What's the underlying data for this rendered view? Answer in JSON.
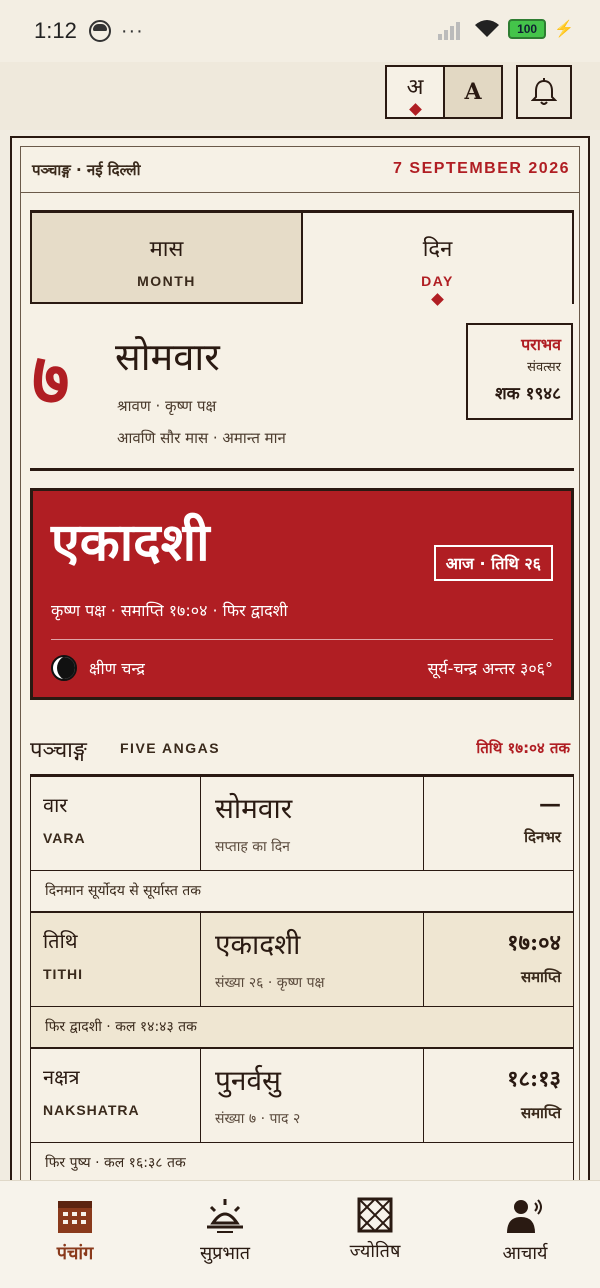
{
  "status_bar": {
    "time": "1:12",
    "dots": "···",
    "battery": "100"
  },
  "toolbar": {
    "lang_hindi": "अ",
    "lang_english": "A"
  },
  "header": {
    "location": "पञ्चाङ्ग · नई दिल्ली",
    "date": "7 SEPTEMBER 2026"
  },
  "tabs": [
    {
      "hindi": "मास",
      "english": "MONTH",
      "active": false
    },
    {
      "hindi": "दिन",
      "english": "DAY",
      "active": true
    }
  ],
  "day": {
    "number": "७",
    "weekday": "सोमवार",
    "line1": "श्रावण · कृष्ण पक्ष",
    "line2": "आवणि सौर मास · अमान्त मान"
  },
  "samvatsara": {
    "name": "पराभव",
    "label": "संवत्सर",
    "year": "शक १९४८"
  },
  "tithi_card": {
    "name": "एकादशी",
    "badge": "आज · तिथि २६",
    "detail": "कृष्ण पक्ष · समाप्ति १७:०४ · फिर द्वादशी",
    "moon_label": "क्षीण चन्द्र",
    "angle": "सूर्य-चन्द्र अन्तर ३०६°"
  },
  "angas_section": {
    "title": "पञ्चाङ्ग",
    "subtitle": "FIVE ANGAS",
    "right": "तिथि १७:०४ तक"
  },
  "angas": [
    {
      "hindi": "वार",
      "english": "VARA",
      "value": "सोमवार",
      "detail": "सप्ताह का दिन",
      "time": "—",
      "time_label": "दिनभर",
      "note": "दिनमान सूर्योदय से सूर्यास्त तक",
      "highlight": false
    },
    {
      "hindi": "तिथि",
      "english": "TITHI",
      "value": "एकादशी",
      "detail": "संख्या २६ · कृष्ण पक्ष",
      "time": "१७:०४",
      "time_label": "समाप्ति",
      "note": "फिर द्वादशी · कल १४:४३ तक",
      "highlight": true
    },
    {
      "hindi": "नक्षत्र",
      "english": "NAKSHATRA",
      "value": "पुनर्वसु",
      "detail": "संख्या ७ · पाद २",
      "time": "१८:१३",
      "time_label": "समाप्ति",
      "note": "फिर पुष्य · कल १६:३८ तक",
      "highlight": false
    }
  ],
  "bottom_nav": [
    {
      "label": "पंचांग",
      "icon": "calendar-icon",
      "active": true
    },
    {
      "label": "सुप्रभात",
      "icon": "sunrise-icon",
      "active": false
    },
    {
      "label": "ज्योतिष",
      "icon": "chart-grid-icon",
      "active": false
    },
    {
      "label": "आचार्य",
      "icon": "acharya-voice-icon",
      "active": false
    }
  ],
  "colors": {
    "accent": "#b01e23",
    "ink": "#2a1a12",
    "paper": "#f6f1e6"
  }
}
